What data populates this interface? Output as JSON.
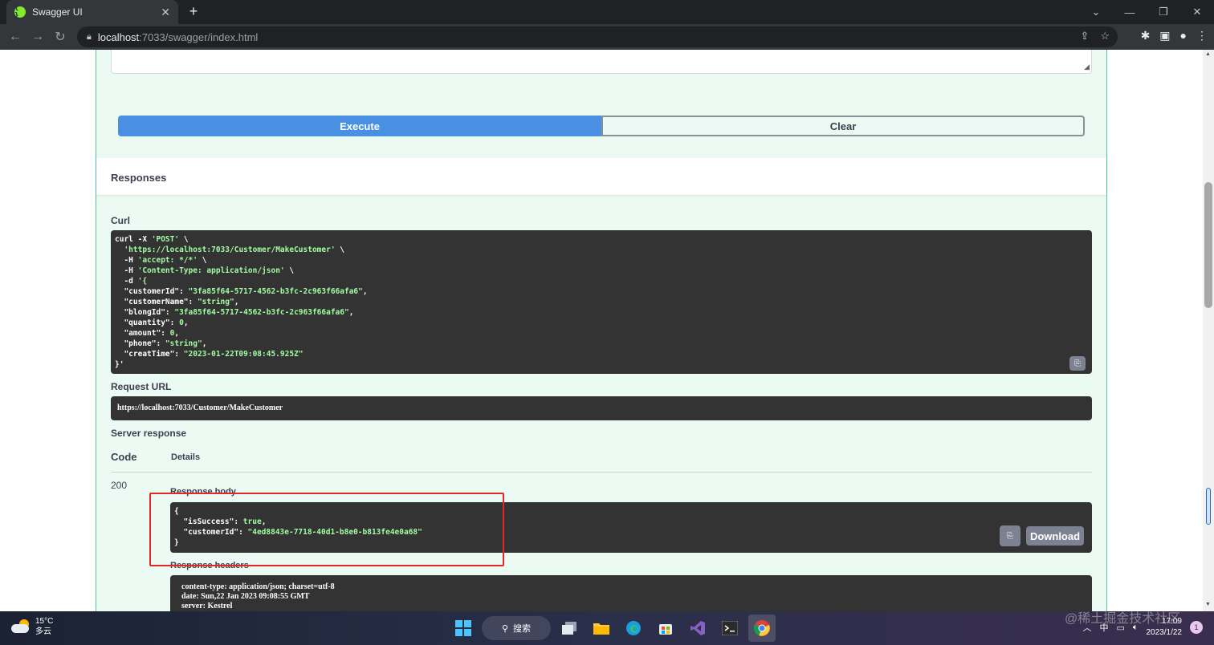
{
  "browser": {
    "tab_title": "Swagger UI",
    "tab_favicon": "{ }",
    "url_host": "localhost",
    "url_path": ":7033/swagger/index.html"
  },
  "actions": {
    "execute_label": "Execute",
    "clear_label": "Clear"
  },
  "responses": {
    "title": "Responses",
    "curl_label": "Curl",
    "request_url_label": "Request URL",
    "request_url": "https://localhost:7033/Customer/MakeCustomer",
    "server_response_label": "Server response",
    "code_header": "Code",
    "details_header": "Details",
    "status_code": "200",
    "response_body_label": "Response body",
    "response_headers_label": "Response headers",
    "download_label": "Download"
  },
  "curl_lines": [
    [
      "curl -X ",
      "'POST'",
      " \\"
    ],
    [
      "  ",
      "'https://localhost:7033/Customer/MakeCustomer'",
      " \\"
    ],
    [
      "  -H ",
      "'accept: */*'",
      " \\"
    ],
    [
      "  -H ",
      "'Content-Type: application/json'",
      " \\"
    ],
    [
      "  -d ",
      "'{",
      ""
    ],
    [
      "  \"customerId\": ",
      "\"3fa85f64-5717-4562-b3fc-2c963f66afa6\"",
      ","
    ],
    [
      "  \"customerName\": ",
      "\"string\"",
      ","
    ],
    [
      "  \"blongId\": ",
      "\"3fa85f64-5717-4562-b3fc-2c963f66afa6\"",
      ","
    ],
    [
      "  \"quantity\": ",
      "0",
      ","
    ],
    [
      "  \"amount\": ",
      "0",
      ","
    ],
    [
      "  \"phone\": ",
      "\"string\"",
      ","
    ],
    [
      "  \"creatTime\": ",
      "\"2023-01-22T09:08:45.925Z\"",
      ""
    ],
    [
      "}'",
      "",
      ""
    ]
  ],
  "response_body_lines": [
    [
      "{",
      "",
      ""
    ],
    [
      "  \"isSuccess\": ",
      "true",
      ","
    ],
    [
      "  \"customerId\": ",
      "\"4ed8843e-7718-40d1-b8e0-b813fe4e0a68\"",
      ""
    ],
    [
      "}",
      "",
      ""
    ]
  ],
  "response_headers_lines": [
    "content-type: application/json; charset=utf-8",
    "date: Sun,22 Jan 2023 09:08:55 GMT",
    "server: Kestrel"
  ],
  "taskbar": {
    "temperature": "15°C",
    "weather": "多云",
    "search_label": "搜索",
    "ime": "中",
    "time": "17:09",
    "date": "2023/1/22",
    "notification_count": "1"
  },
  "watermark": "@稀土掘金技术社区"
}
